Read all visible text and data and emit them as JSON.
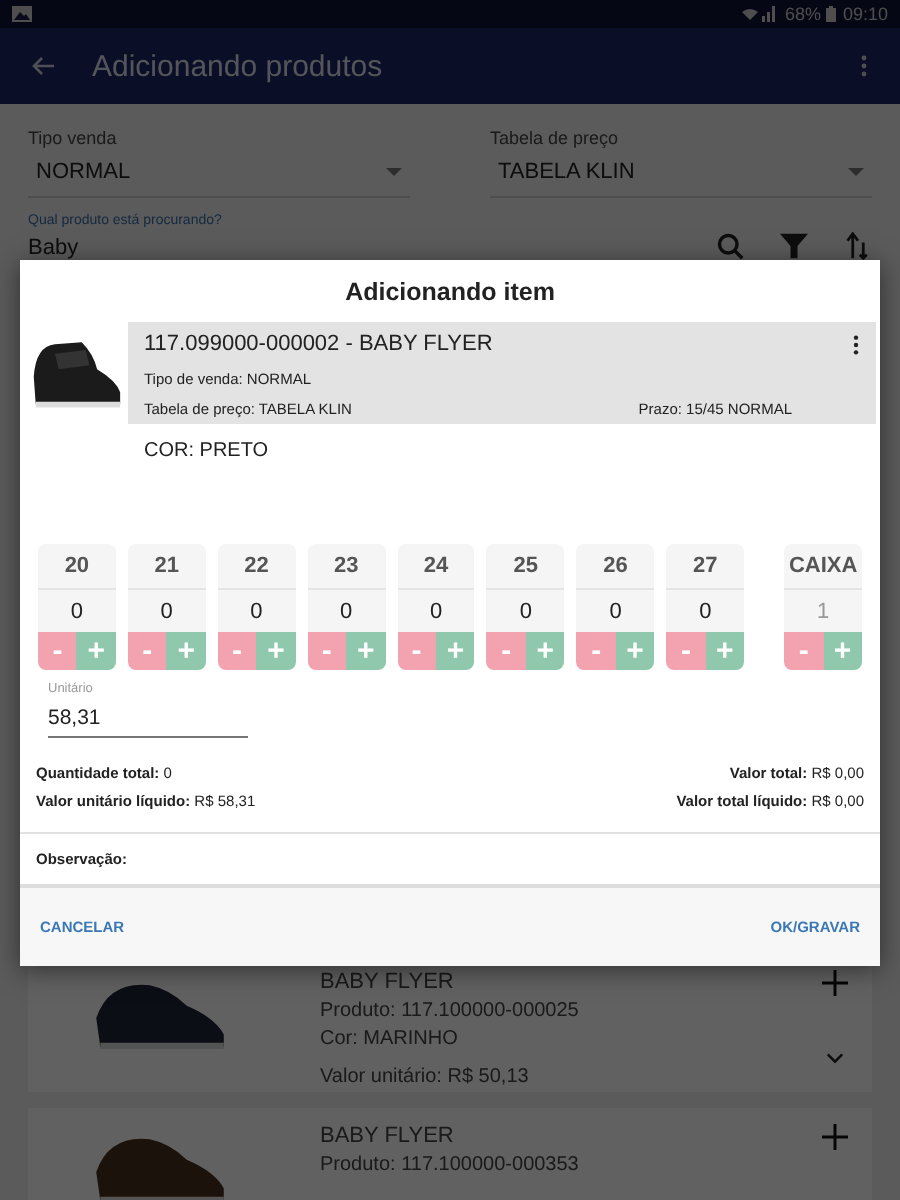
{
  "status_bar": {
    "battery": "68%",
    "time": "09:10"
  },
  "app_bar": {
    "title": "Adicionando produtos"
  },
  "filters": [
    {
      "label": "Tipo venda",
      "value": "NORMAL"
    },
    {
      "label": "Tabela de preço",
      "value": "TABELA KLIN"
    }
  ],
  "search": {
    "label": "Qual produto está procurando?",
    "value": "Baby"
  },
  "products": [
    {
      "name": "BABY FLYER",
      "code": "Produto: 117.100000-000025",
      "color_text": "Cor: MARINHO",
      "price": "Valor unitário: R$ 50,13"
    },
    {
      "name": "BABY FLYER",
      "code": "Produto: 117.100000-000353"
    }
  ],
  "dialog": {
    "title": "Adicionando item",
    "item": {
      "title": "117.099000-000002 - BABY FLYER",
      "sale_type": "Tipo de venda: NORMAL",
      "price_table": "Tabela de preço: TABELA KLIN",
      "term": "Prazo: 15/45 NORMAL"
    },
    "color_text": "COR: PRETO",
    "sizes": [
      {
        "label": "20",
        "qty": "0",
        "disabled": false
      },
      {
        "label": "21",
        "qty": "0",
        "disabled": false
      },
      {
        "label": "22",
        "qty": "0",
        "disabled": false
      },
      {
        "label": "23",
        "qty": "0",
        "disabled": false
      },
      {
        "label": "24",
        "qty": "0",
        "disabled": false
      },
      {
        "label": "25",
        "qty": "0",
        "disabled": false
      },
      {
        "label": "26",
        "qty": "0",
        "disabled": false
      },
      {
        "label": "27",
        "qty": "0",
        "disabled": false
      },
      {
        "label": "CAIXA",
        "qty": "1",
        "disabled": true
      }
    ],
    "minus": "-",
    "plus": "+",
    "unit": {
      "label": "Unitário",
      "value": "58,31"
    },
    "totals_left": [
      {
        "label": "Quantidade total:",
        "value": "0"
      },
      {
        "label": "Valor unitário líquido:",
        "value": "R$ 58,31"
      }
    ],
    "totals_right": [
      {
        "label": "Valor total:",
        "value": "R$ 0,00"
      },
      {
        "label": "Valor total líquido:",
        "value": "R$ 0,00"
      }
    ],
    "note_label": "Observação:",
    "buttons": [
      "CANCELAR",
      "OK/GRAVAR"
    ]
  }
}
